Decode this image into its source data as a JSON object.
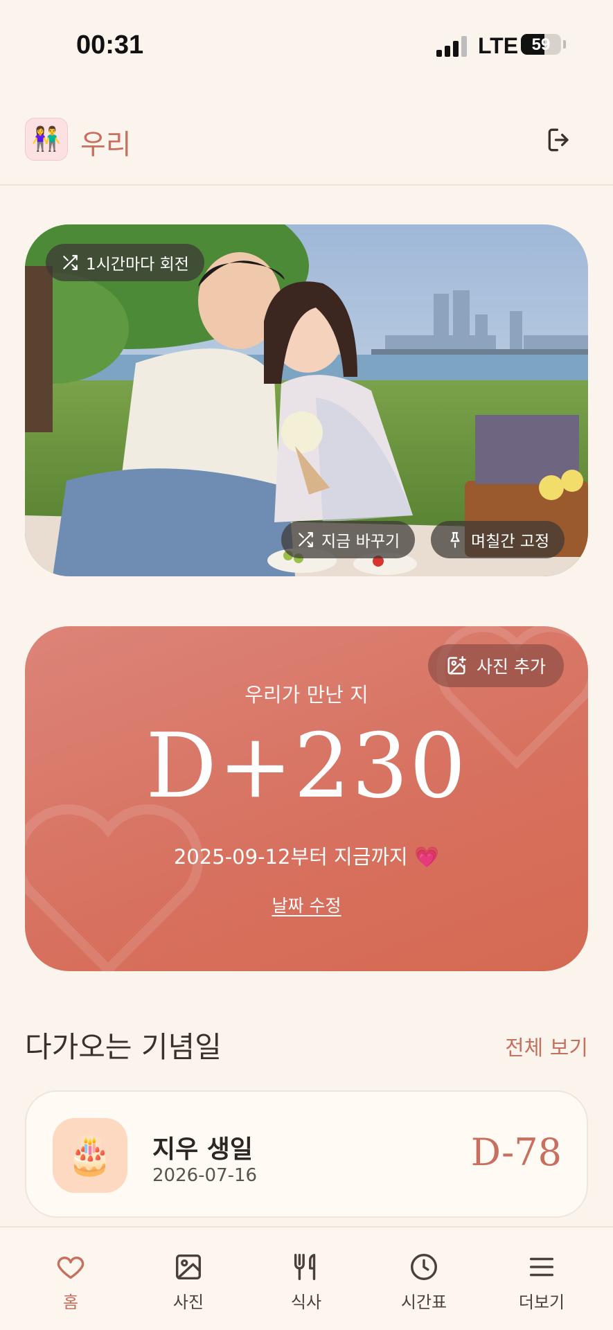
{
  "status_bar": {
    "time": "00:31",
    "network": "LTE",
    "battery": "59",
    "battery_level": 0.59
  },
  "header": {
    "app_title": "우리",
    "logo_icon": "couple-emoji-icon",
    "logout_icon": "logout-icon"
  },
  "photo_card": {
    "rotate_label": "1시간마다 회전",
    "change_now_label": "지금 바꾸기",
    "pin_label": "며칠간 고정"
  },
  "dday": {
    "add_photo_label": "사진 추가",
    "caption": "우리가 만난 지",
    "count": "D+230",
    "since": "2025-09-12부터 지금까지 💗",
    "edit_label": "날짜 수정"
  },
  "anniversaries": {
    "title": "다가오는 기념일",
    "view_all": "전체 보기",
    "items": [
      {
        "icon": "🎂",
        "name": "지우 생일",
        "date": "2026-07-16",
        "dday": "D-78"
      }
    ]
  },
  "nav": {
    "items": [
      {
        "label": "홈",
        "icon": "heart-icon",
        "active": true
      },
      {
        "label": "사진",
        "icon": "image-icon"
      },
      {
        "label": "식사",
        "icon": "utensils-icon"
      },
      {
        "label": "시간표",
        "icon": "clock-icon"
      },
      {
        "label": "더보기",
        "icon": "menu-icon"
      }
    ]
  },
  "colors": {
    "accent": "#c8705f",
    "background": "#fbf4ec",
    "card_gradient_start": "#dc8478",
    "card_gradient_end": "#d56a52"
  }
}
